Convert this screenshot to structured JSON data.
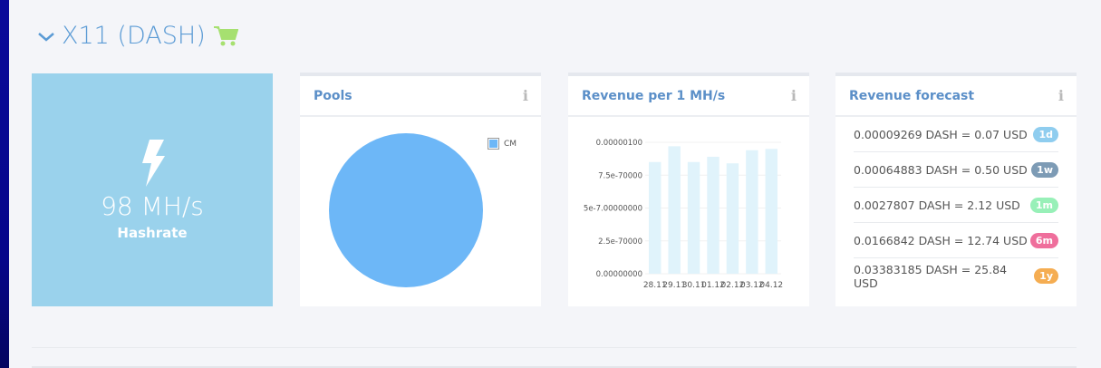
{
  "section": {
    "title": "X11 (DASH)"
  },
  "hashrate": {
    "value": "98 MH/s",
    "label": "Hashrate"
  },
  "pools": {
    "title": "Pools",
    "legend": "CM",
    "color": "#6db7f7"
  },
  "revenue": {
    "title": "Revenue per 1 MH/s"
  },
  "forecast": {
    "title": "Revenue forecast",
    "rows": [
      {
        "text": "0.00009269 DASH = 0.07 USD",
        "badge": "1d",
        "color": "#8fcdef"
      },
      {
        "text": "0.00064883 DASH = 0.50 USD",
        "badge": "1w",
        "color": "#7d9bb5"
      },
      {
        "text": "0.0027807 DASH = 2.12 USD",
        "badge": "1m",
        "color": "#98f0b8"
      },
      {
        "text": "0.0166842 DASH = 12.74 USD",
        "badge": "6m",
        "color": "#ef6f9c"
      },
      {
        "text": "0.03383185 DASH = 25.84 USD",
        "badge": "1y",
        "color": "#f5ad52"
      }
    ]
  },
  "chart_data": {
    "type": "bar",
    "categories": [
      "28.11",
      "29.11",
      "30.11",
      "01.12",
      "02.12",
      "03.12",
      "04.12"
    ],
    "values": [
      8.5e-07,
      9.7e-07,
      8.5e-07,
      8.9e-07,
      8.4e-07,
      9.4e-07,
      9.5e-07
    ],
    "ylim": [
      0,
      1e-06
    ],
    "yticks": [
      "0.00000000",
      "2.5e-70000",
      "5e-7.00000000",
      "7.5e-70000",
      "0.00000100"
    ],
    "color": "#e0f3fb"
  }
}
